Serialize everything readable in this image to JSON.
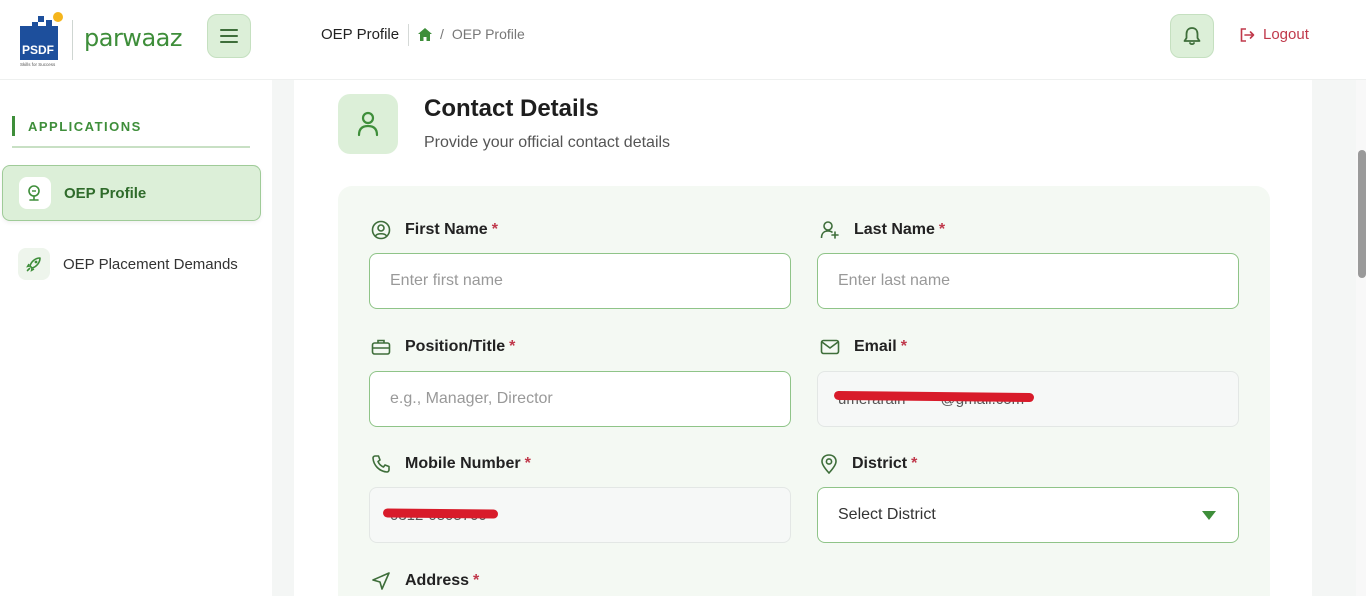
{
  "header": {
    "psdf_logo_text": "PSDF",
    "psdf_tagline": "Skills for Success",
    "brand_name": "parwaaz",
    "page_title": "OEP Profile",
    "breadcrumb_current": "OEP Profile",
    "breadcrumb_sep": "/",
    "logout_label": "Logout"
  },
  "sidebar": {
    "section_label": "APPLICATIONS",
    "items": [
      {
        "label": "OEP Profile",
        "active": true
      },
      {
        "label": "OEP Placement Demands",
        "active": false
      }
    ]
  },
  "section": {
    "title": "Contact Details",
    "subtitle": "Provide your official contact details"
  },
  "form": {
    "first_name": {
      "label": "First Name",
      "placeholder": "Enter first name",
      "required": "*"
    },
    "last_name": {
      "label": "Last Name",
      "placeholder": "Enter last name",
      "required": "*"
    },
    "position": {
      "label": "Position/Title",
      "placeholder": "e.g., Manager, Director",
      "required": "*"
    },
    "email": {
      "label": "Email",
      "value": "umerarain******@gmail.com",
      "required": "*"
    },
    "mobile": {
      "label": "Mobile Number",
      "value": "0312-0505700",
      "required": "*"
    },
    "district": {
      "label": "District",
      "value": "Select District",
      "required": "*"
    },
    "address": {
      "label": "Address",
      "required": "*"
    }
  },
  "colors": {
    "brand_green": "#3e8e3a",
    "accent_light": "#dcefd8",
    "logout_red": "#c0394b"
  }
}
